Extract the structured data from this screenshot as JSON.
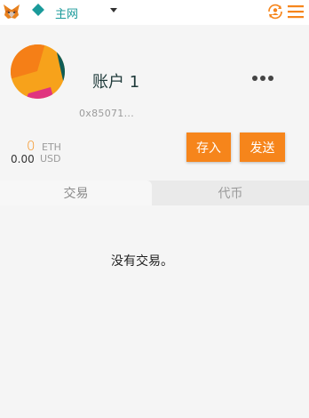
{
  "header": {
    "network_name": "主网",
    "icons": [
      "metamask-fox-icon",
      "network-diamond-icon",
      "chevron-down-icon",
      "account-switch-icon",
      "hamburger-menu-icon"
    ],
    "network_color": "#1a9a9a",
    "accent_color": "#f6851b"
  },
  "account": {
    "name": "账户 1",
    "address_short": "0x85071..."
  },
  "balance": {
    "eth_value": "0",
    "eth_unit": "ETH",
    "usd_value": "0.00",
    "usd_unit": "USD"
  },
  "actions": {
    "deposit_label": "存入",
    "send_label": "发送"
  },
  "tabs": [
    {
      "label": "交易",
      "active": true
    },
    {
      "label": "代币",
      "active": false
    }
  ],
  "transactions": {
    "empty_message": "没有交易。"
  }
}
